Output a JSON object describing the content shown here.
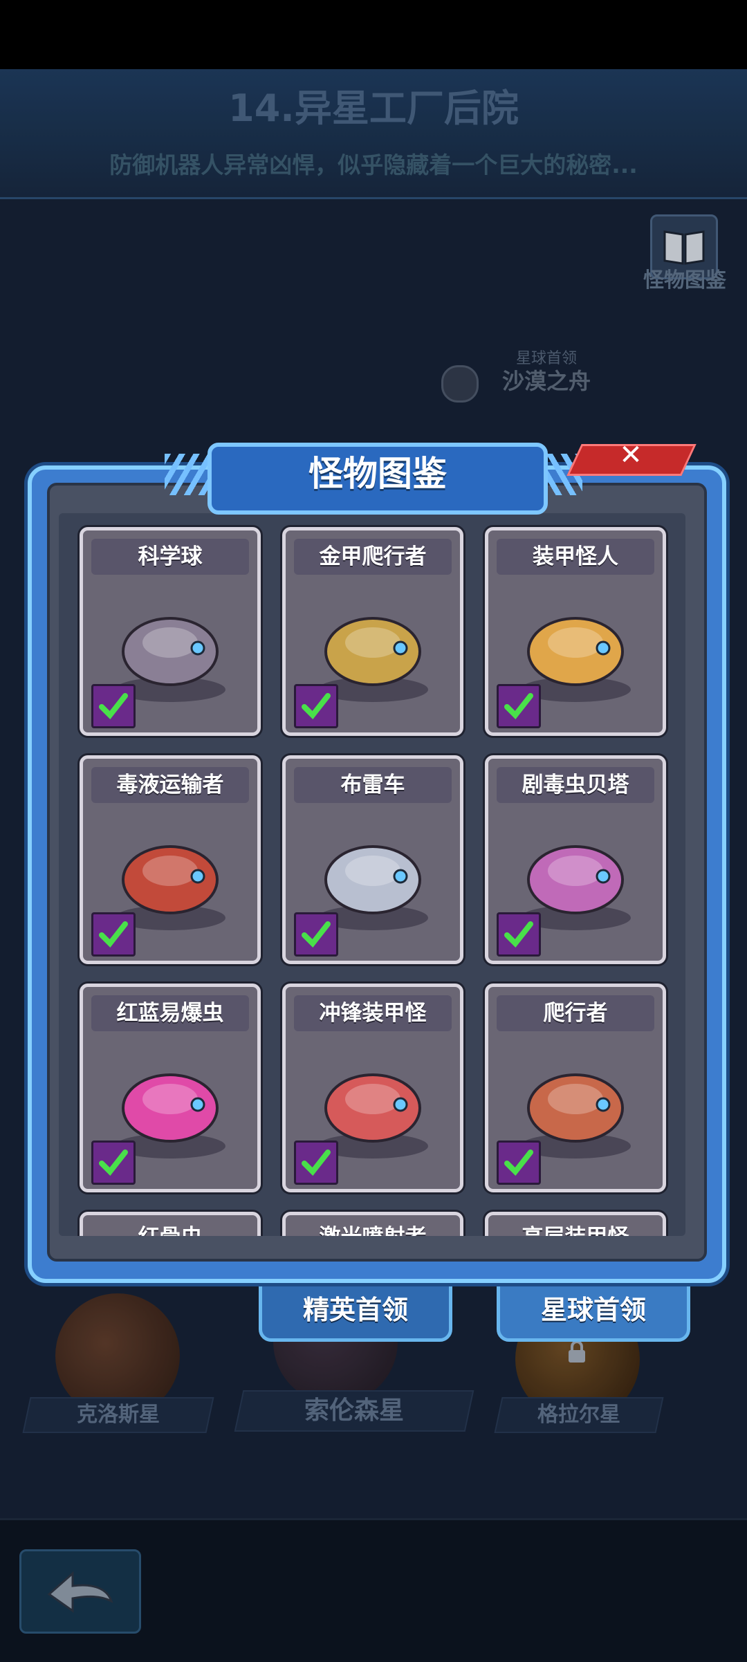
{
  "level": {
    "title": "14.异星工厂后院",
    "description": "防御机器人异常凶悍，似乎隐藏着一个巨大的秘密..."
  },
  "bestiary_button": {
    "label": "怪物图鉴",
    "icon": "book-icon"
  },
  "planet_boss": {
    "tag": "星球首领",
    "name": "沙漠之舟",
    "icon": "skull-icon"
  },
  "planets": [
    {
      "name": "克洛斯星"
    },
    {
      "name": "索伦森星"
    },
    {
      "name": "格拉尔星",
      "locked": true
    }
  ],
  "modal": {
    "title": "怪物图鉴",
    "close_icon": "close-icon",
    "tabs": [
      {
        "label": "精英首领"
      },
      {
        "label": "星球首领"
      }
    ],
    "monsters": [
      {
        "name": "科学球",
        "collected": true,
        "color": "#8a7f95"
      },
      {
        "name": "金甲爬行者",
        "collected": true,
        "color": "#c9a34a"
      },
      {
        "name": "装甲怪人",
        "collected": true,
        "color": "#e0a64a"
      },
      {
        "name": "毒液运输者",
        "collected": true,
        "color": "#c24a3a"
      },
      {
        "name": "布雷车",
        "collected": true,
        "color": "#b8bfd0"
      },
      {
        "name": "剧毒虫贝塔",
        "collected": true,
        "color": "#c06ab8"
      },
      {
        "name": "红蓝易爆虫",
        "collected": true,
        "color": "#e04aa8"
      },
      {
        "name": "冲锋装甲怪",
        "collected": true,
        "color": "#d65a5a"
      },
      {
        "name": "爬行者",
        "collected": true,
        "color": "#c8684a"
      }
    ],
    "partial_monsters": [
      {
        "name": "红骨虫"
      },
      {
        "name": "激光喷射者"
      },
      {
        "name": "高层装甲怪"
      }
    ]
  },
  "back_button": {
    "icon": "back-arrow-icon"
  }
}
